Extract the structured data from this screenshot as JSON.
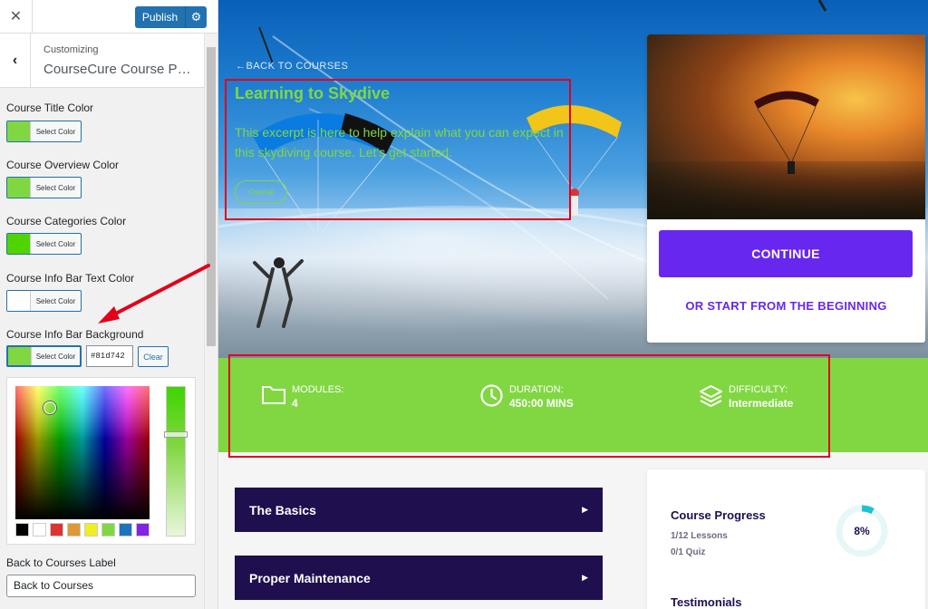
{
  "sidebar": {
    "close_icon": "close-icon",
    "publish_label": "Publish",
    "header_small": "Customizing",
    "header_title": "CourseCure Course Page",
    "controls": [
      {
        "label": "Course Title Color",
        "button": "Select Color",
        "color": "#81d742"
      },
      {
        "label": "Course Overview Color",
        "button": "Select Color",
        "color": "#81d742"
      },
      {
        "label": "Course Categories Color",
        "button": "Select Color",
        "color": "#4fd400"
      },
      {
        "label": "Course Info Bar Text Color",
        "button": "Select Color",
        "color": "#ffffff"
      },
      {
        "label": "Course Info Bar Background",
        "button": "Select Color",
        "color": "#81d742"
      }
    ],
    "hex_value": "#81d742",
    "clear_label": "Clear",
    "palette": [
      "#000000",
      "#ffffff",
      "#dd3333",
      "#dd9933",
      "#eeee22",
      "#81d742",
      "#1e73be",
      "#8224e3"
    ],
    "back_label_title": "Back to Courses Label",
    "back_label_value": "Back to Courses"
  },
  "hero": {
    "back_link": "Back to Courses",
    "title": "Learning to Skydive",
    "excerpt": "This excerpt is here to help explain what you can expect in this skydiving course. Let's get started.",
    "pill": "Overall",
    "title_color": "#81d742"
  },
  "cta": {
    "continue": "CONTINUE",
    "restart": "OR START FROM THE BEGINNING",
    "accent": "#6727ef"
  },
  "info_bar": {
    "background": "#81d742",
    "items": [
      {
        "icon": "folder-icon",
        "key": "MODULES:",
        "value": "4"
      },
      {
        "icon": "clock-icon",
        "key": "DURATION:",
        "value": "450:00 MINS"
      },
      {
        "icon": "layers-icon",
        "key": "DIFFICULTY:",
        "value": "Intermediate"
      }
    ]
  },
  "modules": [
    {
      "title": "The Basics"
    },
    {
      "title": "Proper Maintenance"
    }
  ],
  "progress": {
    "title": "Course Progress",
    "lessons": "1/12 Lessons",
    "quiz": "0/1 Quiz",
    "percent": 8,
    "percent_label": "8%",
    "testimonials": "Testimonials"
  }
}
